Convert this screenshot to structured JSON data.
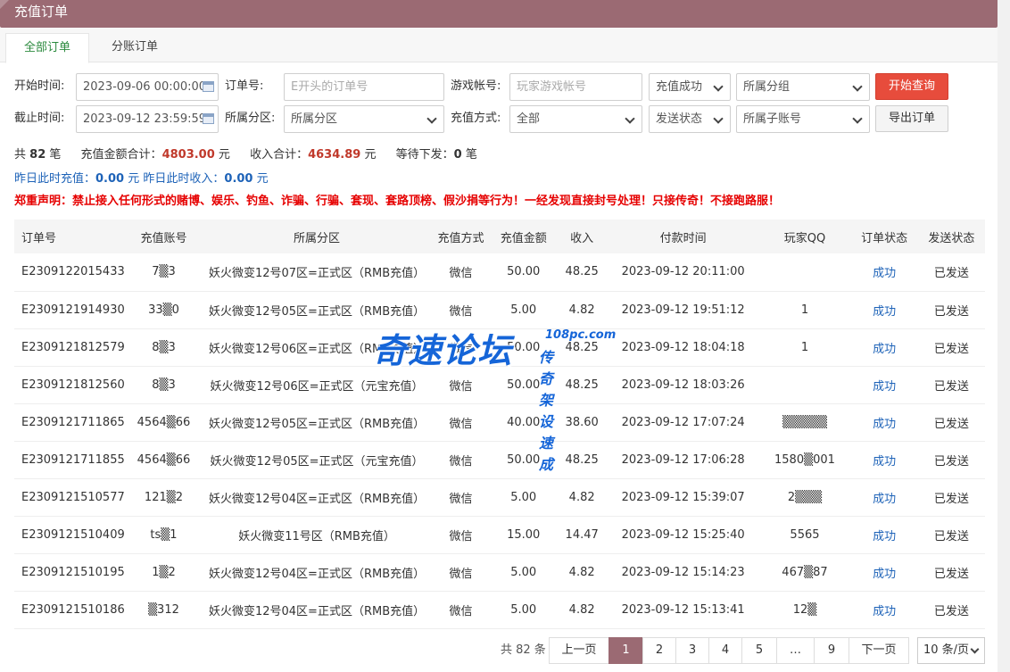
{
  "header": {
    "title": "充值订单"
  },
  "tabs": [
    {
      "label": "全部订单"
    },
    {
      "label": "分账订单"
    }
  ],
  "filters": {
    "start_time_label": "开始时间:",
    "start_time_value": "2023-09-06 00:00:00",
    "end_time_label": "截止时间:",
    "end_time_value": "2023-09-12 23:59:59",
    "order_no_label": "订单号:",
    "order_no_placeholder": "E开头的订单号",
    "zone_label": "所属分区:",
    "zone_value": "所属分区",
    "game_account_label": "游戏帐号:",
    "game_account_placeholder": "玩家游戏帐号",
    "pay_method_label": "充值方式:",
    "pay_method_value": "全部",
    "recharge_status_value": "充值成功",
    "send_status_value": "发送状态",
    "group_value": "所属分组",
    "sub_account_value": "所属子账号",
    "search_button": "开始查询",
    "export_button": "导出订单"
  },
  "summary": {
    "count_prefix": "共",
    "count": "82",
    "count_suffix": "笔",
    "recharge_label": "充值金额合计：",
    "recharge_total": "4803.00",
    "recharge_unit": "元",
    "income_label": "收入合计：",
    "income_total": "4634.89",
    "income_unit": "元",
    "pending_label": "等待下发：",
    "pending_count": "0",
    "pending_unit": "笔",
    "yesterday_recharge_label": "昨日此时充值：",
    "yesterday_recharge": "0.00",
    "yesterday_recharge_unit": "元",
    "yesterday_income_label": "昨日此时收入：",
    "yesterday_income": "0.00",
    "yesterday_income_unit": "元",
    "notice": "郑重声明：禁止接入任何形式的赌博、娱乐、钓鱼、诈骗、行骗、套现、套路顶榜、假沙捐等行为！一经发现直接封号处理！只接传奇！不接跑路服！"
  },
  "table": {
    "headers": [
      "订单号",
      "充值账号",
      "所属分区",
      "充值方式",
      "充值金额",
      "收入",
      "付款时间",
      "玩家QQ",
      "订单状态",
      "发送状态"
    ],
    "rows": [
      [
        "E2309122015433",
        "7▒3",
        "妖火微变12号07区=正式区（RMB充值）",
        "微信",
        "50.00",
        "48.25",
        "2023-09-12 20:11:00",
        "",
        "成功",
        "已发送"
      ],
      [
        "E2309121914930",
        "33▒0",
        "妖火微变12号05区=正式区（RMB充值）",
        "微信",
        "5.00",
        "4.82",
        "2023-09-12 19:51:12",
        "1",
        "成功",
        "已发送"
      ],
      [
        "E2309121812579",
        "8▒3",
        "妖火微变12号06区=正式区（RMB充值）",
        "微信",
        "50.00",
        "48.25",
        "2023-09-12 18:04:18",
        "1",
        "成功",
        "已发送"
      ],
      [
        "E2309121812560",
        "8▒3",
        "妖火微变12号06区=正式区（元宝充值）",
        "微信",
        "50.00",
        "48.25",
        "2023-09-12 18:03:26",
        "",
        "成功",
        "已发送"
      ],
      [
        "E2309121711865",
        "4564▒66",
        "妖火微变12号05区=正式区（RMB充值）",
        "微信",
        "40.00",
        "38.60",
        "2023-09-12 17:07:24",
        "▒▒▒▒▒",
        "成功",
        "已发送"
      ],
      [
        "E2309121711855",
        "4564▒66",
        "妖火微变12号05区=正式区（元宝充值）",
        "微信",
        "50.00",
        "48.25",
        "2023-09-12 17:06:28",
        "1580▒001",
        "成功",
        "已发送"
      ],
      [
        "E2309121510577",
        "121▒2",
        "妖火微变12号04区=正式区（RMB充值）",
        "微信",
        "5.00",
        "4.82",
        "2023-09-12 15:39:07",
        "2▒▒▒",
        "成功",
        "已发送"
      ],
      [
        "E2309121510409",
        "ts▒1",
        "妖火微变11号区（RMB充值）",
        "微信",
        "15.00",
        "14.47",
        "2023-09-12 15:25:40",
        "5565",
        "成功",
        "已发送"
      ],
      [
        "E2309121510195",
        "1▒2",
        "妖火微变12号04区=正式区（RMB充值）",
        "微信",
        "5.00",
        "4.82",
        "2023-09-12 15:14:23",
        "467▒87",
        "成功",
        "已发送"
      ],
      [
        "E2309121510186",
        "▒312",
        "妖火微变12号04区=正式区（RMB充值）",
        "微信",
        "5.00",
        "4.82",
        "2023-09-12 15:13:41",
        "12▒",
        "成功",
        "已发送"
      ]
    ]
  },
  "watermark": {
    "main": "奇速论坛",
    "url": "108pc.com",
    "sub": "传奇架设速成"
  },
  "pagination": {
    "total": "共 82 条",
    "prev": "上一页",
    "pages": [
      "1",
      "2",
      "3",
      "4",
      "5",
      "…",
      "9"
    ],
    "current": "1",
    "next": "下一页",
    "page_size": "10 条/页"
  }
}
